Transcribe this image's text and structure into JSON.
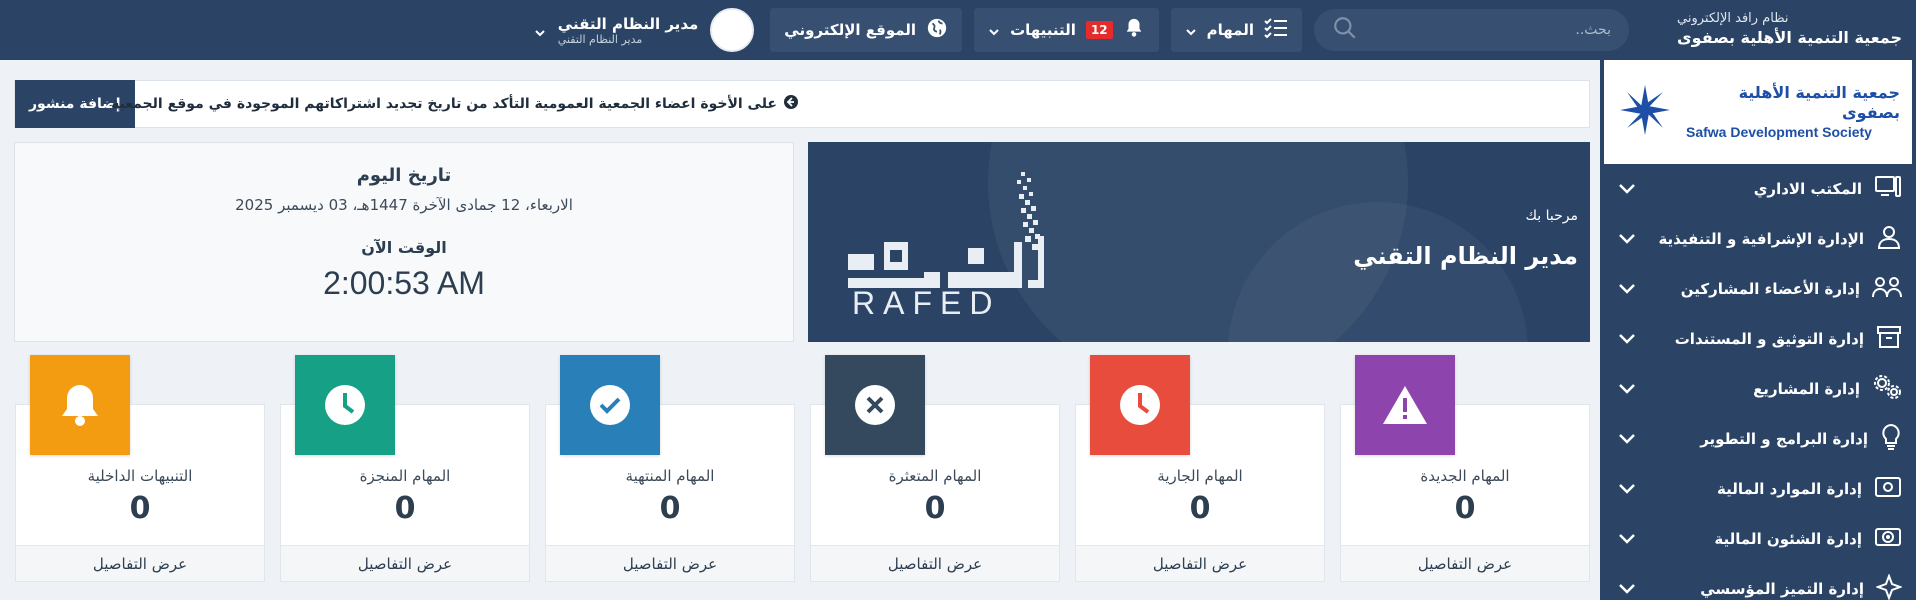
{
  "topbar": {
    "system_name": "نظام رافد الإلكتروني",
    "org_name": "جمعية التنمية الأهلية بصفوى",
    "search_placeholder": "بحث..",
    "tasks_label": "المهام",
    "notifications_label": "التنبيهات",
    "notifications_count": "12",
    "website_label": "الموقع الإلكتروني",
    "user_name": "مدير النظام التقني",
    "user_role": "مدير النظام التقني"
  },
  "sidebar": {
    "logo_ar": "جمعية التنمية الأهلية بصفوى",
    "logo_en": "Safwa Development Society",
    "items": [
      {
        "label": "المكتب الاداري",
        "icon": "monitor-icon"
      },
      {
        "label": "الإدارة الإشرافية و التنفيذية",
        "icon": "user-icon"
      },
      {
        "label": "إدارة الأعضاء المشاركين",
        "icon": "users-icon"
      },
      {
        "label": "إدارة التوثيق و المستندات",
        "icon": "archive-icon"
      },
      {
        "label": "إدارة المشاريع",
        "icon": "gears-icon"
      },
      {
        "label": "إدارة البرامج و التطوير",
        "icon": "lightbulb-icon"
      },
      {
        "label": "إدارة الموارد المالية",
        "icon": "money-icon"
      },
      {
        "label": "إدارة الشئون المالية",
        "icon": "cash-icon"
      },
      {
        "label": "إدارة التميز المؤسسي",
        "icon": "sparkle-icon"
      }
    ]
  },
  "ticker": {
    "add_post_label": "إضافة منشور",
    "message": "على الأخوة اعضاء الجمعية العمومية التأكد من تاريخ تجديد اشتراكاتهم الموجودة في موقع الجمعية"
  },
  "welcome": {
    "greeting": "مرحبا بك",
    "name": "مدير النظام التقني",
    "logo_latin": "RAFED",
    "logo_arabic": "رافد"
  },
  "datebox": {
    "today_title": "تاريخ اليوم",
    "today_value": "الاربعاء، 12 جمادى الآخرة 1447هـ، 03 ديسمبر 2025",
    "time_title": "الوقت الآن",
    "time_value": "2:00:53 AM"
  },
  "cards": [
    {
      "title": "المهام الجديدة",
      "value": "0",
      "footer": "عرض التفاصيل",
      "color": "#8e44ad",
      "icon": "warning-icon"
    },
    {
      "title": "المهام الجارية",
      "value": "0",
      "footer": "عرض التفاصيل",
      "color": "#e74c3c",
      "icon": "clock-icon"
    },
    {
      "title": "المهام المتعثرة",
      "value": "0",
      "footer": "عرض التفاصيل",
      "color": "#34495e",
      "icon": "x-circle-icon"
    },
    {
      "title": "المهام المنتهية",
      "value": "0",
      "footer": "عرض التفاصيل",
      "color": "#2980b9",
      "icon": "check-circle-icon"
    },
    {
      "title": "المهام المنجزة",
      "value": "0",
      "footer": "عرض التفاصيل",
      "color": "#16a085",
      "icon": "clock-icon"
    },
    {
      "title": "التنبيهات الداخلية",
      "value": "0",
      "footer": "عرض التفاصيل",
      "color": "#f39c12",
      "icon": "bell-icon"
    }
  ]
}
